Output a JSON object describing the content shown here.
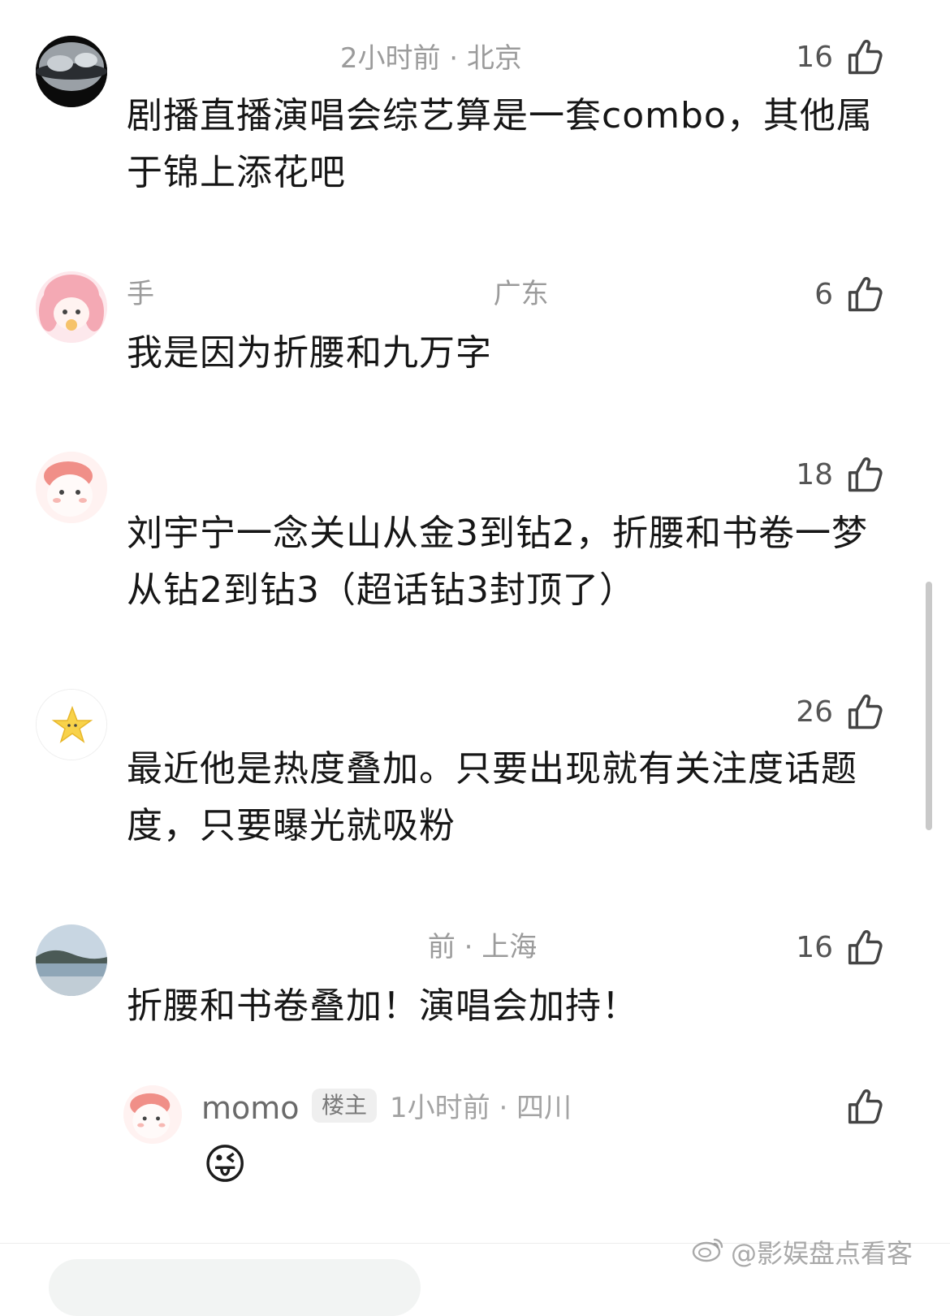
{
  "comments": [
    {
      "username_hint": "",
      "meta": "2小时前 · 北京",
      "likes": "16",
      "text": "剧播直播演唱会综艺算是一套combo，其他属于锦上添花吧"
    },
    {
      "username_hint": "手",
      "meta": "广东",
      "likes": "6",
      "text": "我是因为折腰和九万字"
    },
    {
      "username_hint": "",
      "meta": "",
      "likes": "18",
      "text": "刘宇宁一念关山从金3到钻2，折腰和书卷一梦从钻2到钻3（超话钻3封顶了）"
    },
    {
      "username_hint": "",
      "meta": "",
      "likes": "26",
      "text": "最近他是热度叠加。只要出现就有关注度话题度，只要曝光就吸粉"
    },
    {
      "username_hint": "",
      "meta": "前 · 上海",
      "likes": "16",
      "text": "折腰和书卷叠加！演唱会加持！"
    }
  ],
  "reply": {
    "name": "momo",
    "badge": "楼主",
    "meta": "1小时前 · 四川",
    "emoji": "😜"
  },
  "icons": {
    "like": "thumbs-up-icon",
    "weibo": "weibo-logo-icon"
  },
  "watermark": {
    "text": "@影娱盘点看客"
  }
}
